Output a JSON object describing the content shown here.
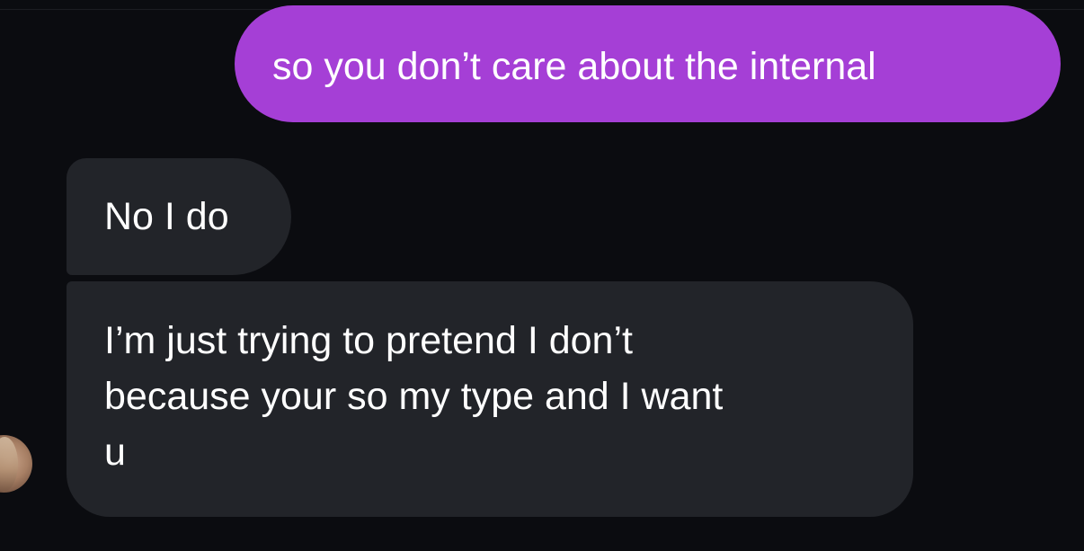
{
  "messages": [
    {
      "direction": "sent",
      "text": "so you don’t care about the internal"
    },
    {
      "direction": "received",
      "text": "No I do"
    },
    {
      "direction": "received",
      "text": "I’m just trying to pretend I don’t\nbecause your so my type and I want\nu"
    }
  ],
  "colors": {
    "background": "#0b0c10",
    "sent_bubble": "#a53fd6",
    "received_bubble": "#222429",
    "text": "#ffffff"
  },
  "contact": {
    "avatar_icon": "profile-photo-icon"
  }
}
